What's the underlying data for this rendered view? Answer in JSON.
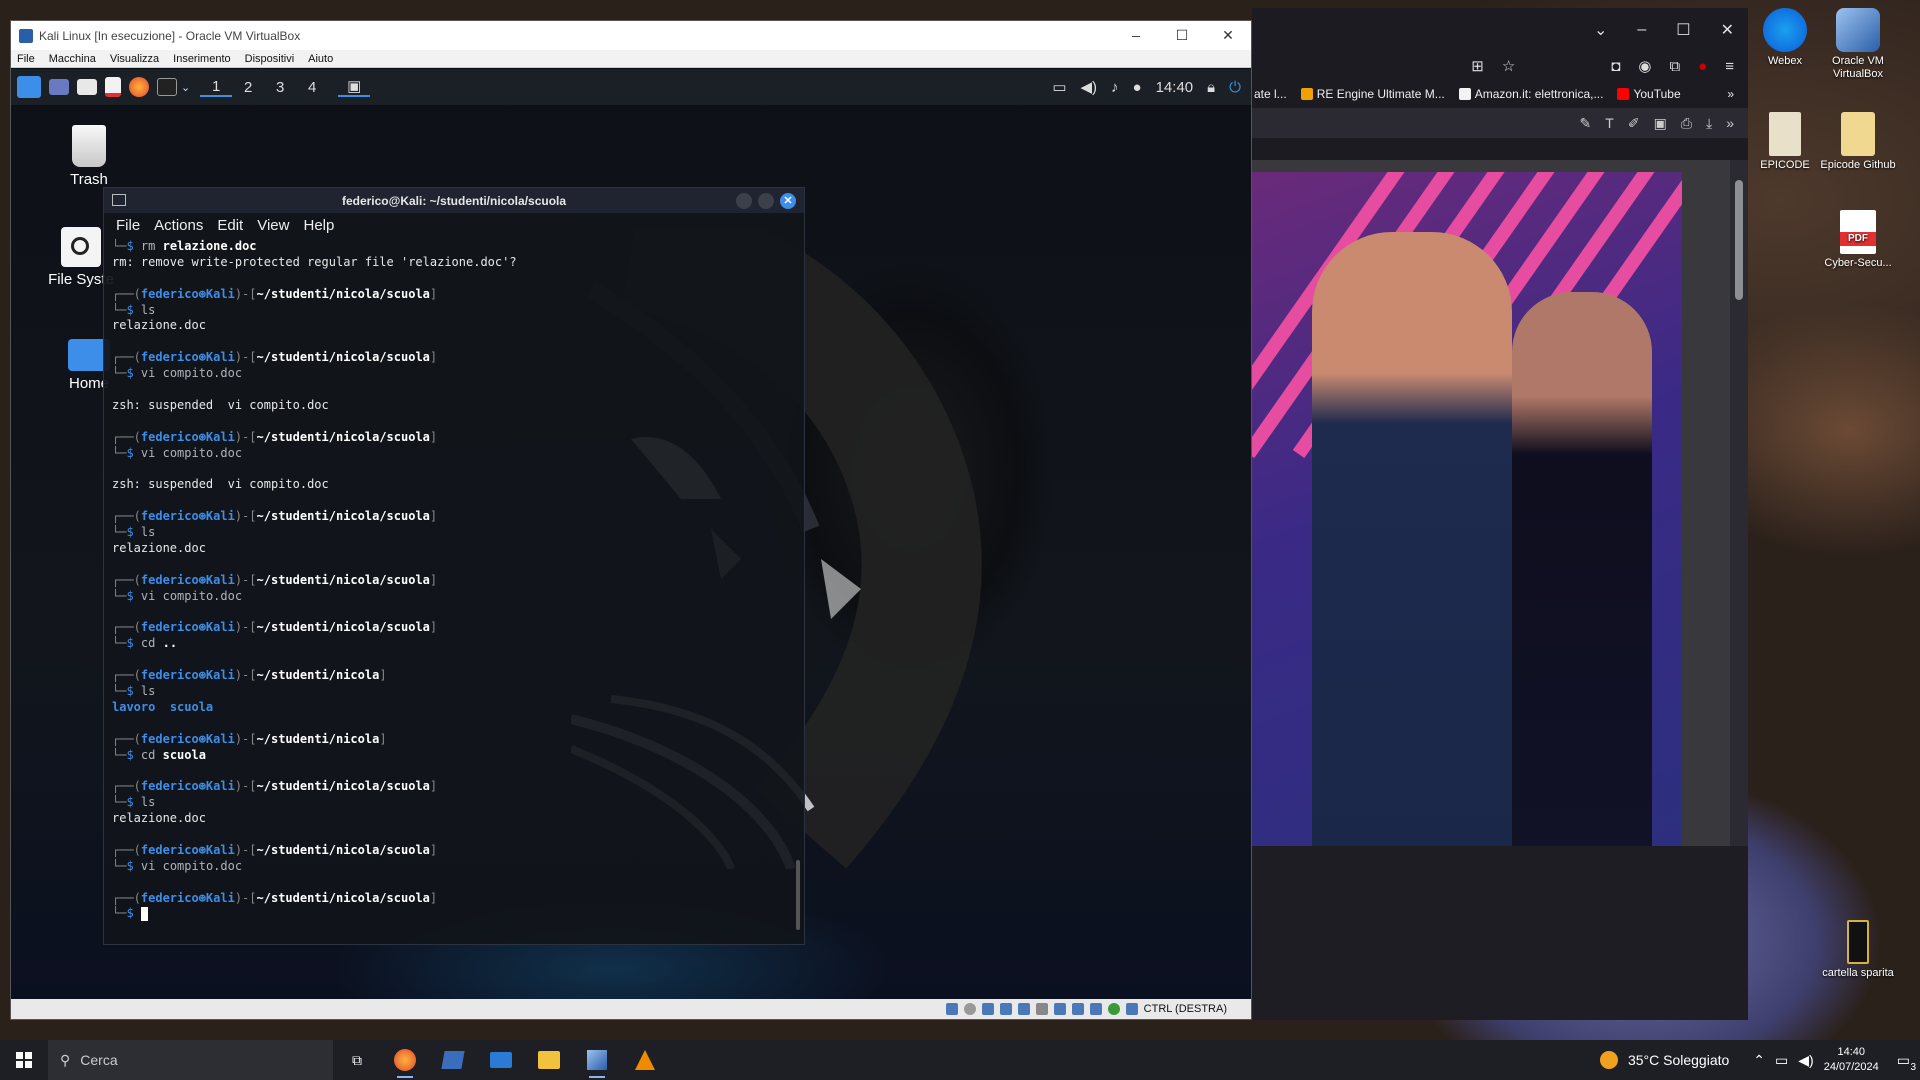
{
  "vm_window": {
    "title": "Kali Linux [In esecuzione] - Oracle VM VirtualBox",
    "menu": [
      "File",
      "Macchina",
      "Visualizza",
      "Inserimento",
      "Dispositivi",
      "Aiuto"
    ],
    "status_host_key": "CTRL (DESTRA)"
  },
  "kali_panel": {
    "workspaces": [
      "1",
      "2",
      "3",
      "4"
    ],
    "active_workspace": "1",
    "clock": "14:40"
  },
  "kali_desktop": {
    "icons": [
      {
        "label": "Trash",
        "icon": "trash-icon"
      },
      {
        "label": "File Syste",
        "icon": "drive-icon"
      },
      {
        "label": "Home",
        "icon": "home-folder-icon"
      }
    ]
  },
  "terminal": {
    "title": "federico@Kali: ~/studenti/nicola/scuola",
    "menu": [
      "File",
      "Actions",
      "Edit",
      "View",
      "Help"
    ],
    "user": "federico",
    "host": "Kali",
    "separator": "⊛",
    "lines": [
      {
        "t": "cmd",
        "cmd": "rm",
        "arg": "relazione.doc",
        "partial": true
      },
      {
        "t": "out",
        "text": "rm: remove write-protected regular file 'relazione.doc'?"
      },
      {
        "t": "blank"
      },
      {
        "t": "prompt",
        "path": "~/studenti/nicola/scuola"
      },
      {
        "t": "cmd",
        "cmd": "ls",
        "arg": ""
      },
      {
        "t": "out",
        "text": "relazione.doc"
      },
      {
        "t": "blank"
      },
      {
        "t": "prompt",
        "path": "~/studenti/nicola/scuola"
      },
      {
        "t": "cmd",
        "cmd": "vi",
        "arg": "compito.doc",
        "plain": true
      },
      {
        "t": "blank"
      },
      {
        "t": "out",
        "text": "zsh: suspended  vi compito.doc"
      },
      {
        "t": "blank"
      },
      {
        "t": "prompt",
        "path": "~/studenti/nicola/scuola"
      },
      {
        "t": "cmd",
        "cmd": "vi",
        "arg": "compito.doc",
        "plain": true
      },
      {
        "t": "blank"
      },
      {
        "t": "out",
        "text": "zsh: suspended  vi compito.doc"
      },
      {
        "t": "blank"
      },
      {
        "t": "prompt",
        "path": "~/studenti/nicola/scuola"
      },
      {
        "t": "cmd",
        "cmd": "ls",
        "arg": ""
      },
      {
        "t": "out",
        "text": "relazione.doc"
      },
      {
        "t": "blank"
      },
      {
        "t": "prompt",
        "path": "~/studenti/nicola/scuola"
      },
      {
        "t": "cmd",
        "cmd": "vi",
        "arg": "compito.doc",
        "plain": true
      },
      {
        "t": "blank"
      },
      {
        "t": "prompt",
        "path": "~/studenti/nicola/scuola"
      },
      {
        "t": "cmd",
        "cmd": "cd",
        "arg": ".."
      },
      {
        "t": "blank"
      },
      {
        "t": "prompt",
        "path": "~/studenti/nicola"
      },
      {
        "t": "cmd",
        "cmd": "ls",
        "arg": ""
      },
      {
        "t": "dirs",
        "items": [
          "lavoro",
          "scuola"
        ]
      },
      {
        "t": "blank"
      },
      {
        "t": "prompt",
        "path": "~/studenti/nicola"
      },
      {
        "t": "cmd",
        "cmd": "cd",
        "arg": "scuola"
      },
      {
        "t": "blank"
      },
      {
        "t": "prompt",
        "path": "~/studenti/nicola/scuola"
      },
      {
        "t": "cmd",
        "cmd": "ls",
        "arg": ""
      },
      {
        "t": "out",
        "text": "relazione.doc"
      },
      {
        "t": "blank"
      },
      {
        "t": "prompt",
        "path": "~/studenti/nicola/scuola"
      },
      {
        "t": "cmd",
        "cmd": "vi",
        "arg": "compito.doc",
        "plain": true
      },
      {
        "t": "blank"
      },
      {
        "t": "prompt",
        "path": "~/studenti/nicola/scuola"
      },
      {
        "t": "cursor"
      }
    ]
  },
  "browser": {
    "bookmarks": [
      {
        "label": "ate l...",
        "color": "#888888"
      },
      {
        "label": "RE Engine Ultimate M...",
        "color": "#f0a000"
      },
      {
        "label": "Amazon.it: elettronica,...",
        "color": "#f3f3f3"
      },
      {
        "label": "YouTube",
        "color": "#ff0000"
      }
    ]
  },
  "host_desktop": {
    "icons": [
      {
        "label": "Webex",
        "icon": "webex-icon",
        "color": "#0e5bd8"
      },
      {
        "label": "Oracle VM VirtualBox",
        "icon": "virtualbox-icon",
        "color": "#2a5ea8"
      },
      {
        "label": "EPICODE",
        "icon": "epicode-icon",
        "color": "#e8e0c8"
      },
      {
        "label": "Epicode Github",
        "icon": "folder-icon",
        "color": "#f0d890"
      },
      {
        "label": "Cyber-Secu...",
        "icon": "pdf-icon",
        "color": "#e03030"
      },
      {
        "label": "cartella sparita",
        "icon": "folder-icon",
        "color": "#222222"
      }
    ]
  },
  "taskbar": {
    "search_placeholder": "Cerca",
    "weather": "35°C  Soleggiato",
    "time": "14:40",
    "date": "24/07/2024",
    "notifications": "3"
  }
}
